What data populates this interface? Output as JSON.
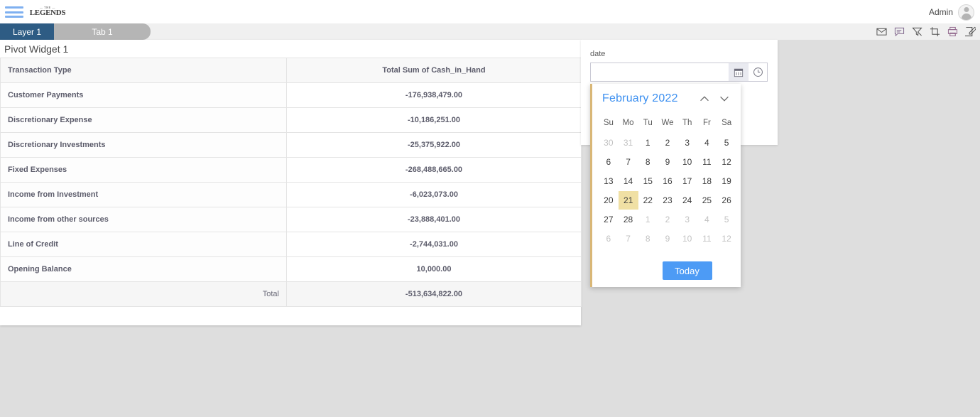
{
  "header": {
    "menu_icon": "hamburger-icon",
    "logo_top": "— THE —",
    "logo_main": "LEGENDS",
    "user_label": "Admin",
    "avatar_icon": "user-avatar-icon"
  },
  "tabs": [
    {
      "label": "Layer 1",
      "active": true
    },
    {
      "label": "Tab 1",
      "active": false
    }
  ],
  "toolbar_icons": [
    {
      "name": "mail-icon"
    },
    {
      "name": "comment-icon"
    },
    {
      "name": "filter-icon"
    },
    {
      "name": "crop-icon"
    },
    {
      "name": "print-icon"
    },
    {
      "name": "edit-icon"
    }
  ],
  "pivot": {
    "title": "Pivot Widget 1",
    "columns": [
      "Transaction Type",
      "Total Sum of Cash_in_Hand"
    ],
    "rows": [
      {
        "label": "Customer Payments",
        "value": "-176,938,479.00"
      },
      {
        "label": "Discretionary Expense",
        "value": "-10,186,251.00"
      },
      {
        "label": "Discretionary Investments",
        "value": "-25,375,922.00"
      },
      {
        "label": "Fixed Expenses",
        "value": "-268,488,665.00"
      },
      {
        "label": "Income from Investment",
        "value": "-6,023,073.00"
      },
      {
        "label": "Income from other sources",
        "value": "-23,888,401.00"
      },
      {
        "label": "Line of Credit",
        "value": "-2,744,031.00"
      },
      {
        "label": "Opening Balance",
        "value": "10,000.00"
      }
    ],
    "total": {
      "label": "Total",
      "value": "-513,634,822.00"
    }
  },
  "date_widget": {
    "label": "date",
    "input_value": "",
    "input_placeholder": "",
    "calendar_icon": "calendar-icon",
    "clock_icon": "clock-icon"
  },
  "calendar": {
    "month_year": "February 2022",
    "prev_icon": "chevron-up-icon",
    "next_icon": "chevron-down-icon",
    "weekdays": [
      "Su",
      "Mo",
      "Tu",
      "We",
      "Th",
      "Fr",
      "Sa"
    ],
    "weeks": [
      [
        {
          "d": "30",
          "muted": true
        },
        {
          "d": "31",
          "muted": true
        },
        {
          "d": "1"
        },
        {
          "d": "2"
        },
        {
          "d": "3"
        },
        {
          "d": "4"
        },
        {
          "d": "5"
        }
      ],
      [
        {
          "d": "6"
        },
        {
          "d": "7"
        },
        {
          "d": "8"
        },
        {
          "d": "9"
        },
        {
          "d": "10"
        },
        {
          "d": "11"
        },
        {
          "d": "12"
        }
      ],
      [
        {
          "d": "13"
        },
        {
          "d": "14"
        },
        {
          "d": "15"
        },
        {
          "d": "16"
        },
        {
          "d": "17"
        },
        {
          "d": "18"
        },
        {
          "d": "19"
        }
      ],
      [
        {
          "d": "20"
        },
        {
          "d": "21",
          "selected": true
        },
        {
          "d": "22"
        },
        {
          "d": "23"
        },
        {
          "d": "24"
        },
        {
          "d": "25"
        },
        {
          "d": "26"
        }
      ],
      [
        {
          "d": "27"
        },
        {
          "d": "28"
        },
        {
          "d": "1",
          "muted": true
        },
        {
          "d": "2",
          "muted": true
        },
        {
          "d": "3",
          "muted": true
        },
        {
          "d": "4",
          "muted": true
        },
        {
          "d": "5",
          "muted": true
        }
      ],
      [
        {
          "d": "6",
          "muted": true
        },
        {
          "d": "7",
          "muted": true
        },
        {
          "d": "8",
          "muted": true
        },
        {
          "d": "9",
          "muted": true
        },
        {
          "d": "10",
          "muted": true
        },
        {
          "d": "11",
          "muted": true
        },
        {
          "d": "12",
          "muted": true
        }
      ]
    ],
    "today_label": "Today",
    "selected_day": "21"
  },
  "colors": {
    "page_background": "#dedede",
    "tab_active": "#2e5c84",
    "tab_inactive": "#b5b5b5",
    "accent_blue": "#3b8ff0",
    "today_button": "#4d9bf5",
    "selected_day_bg": "#f0e0a4",
    "calendar_accent_border": "#d9b777",
    "hamburger": "#7fb0f0"
  }
}
